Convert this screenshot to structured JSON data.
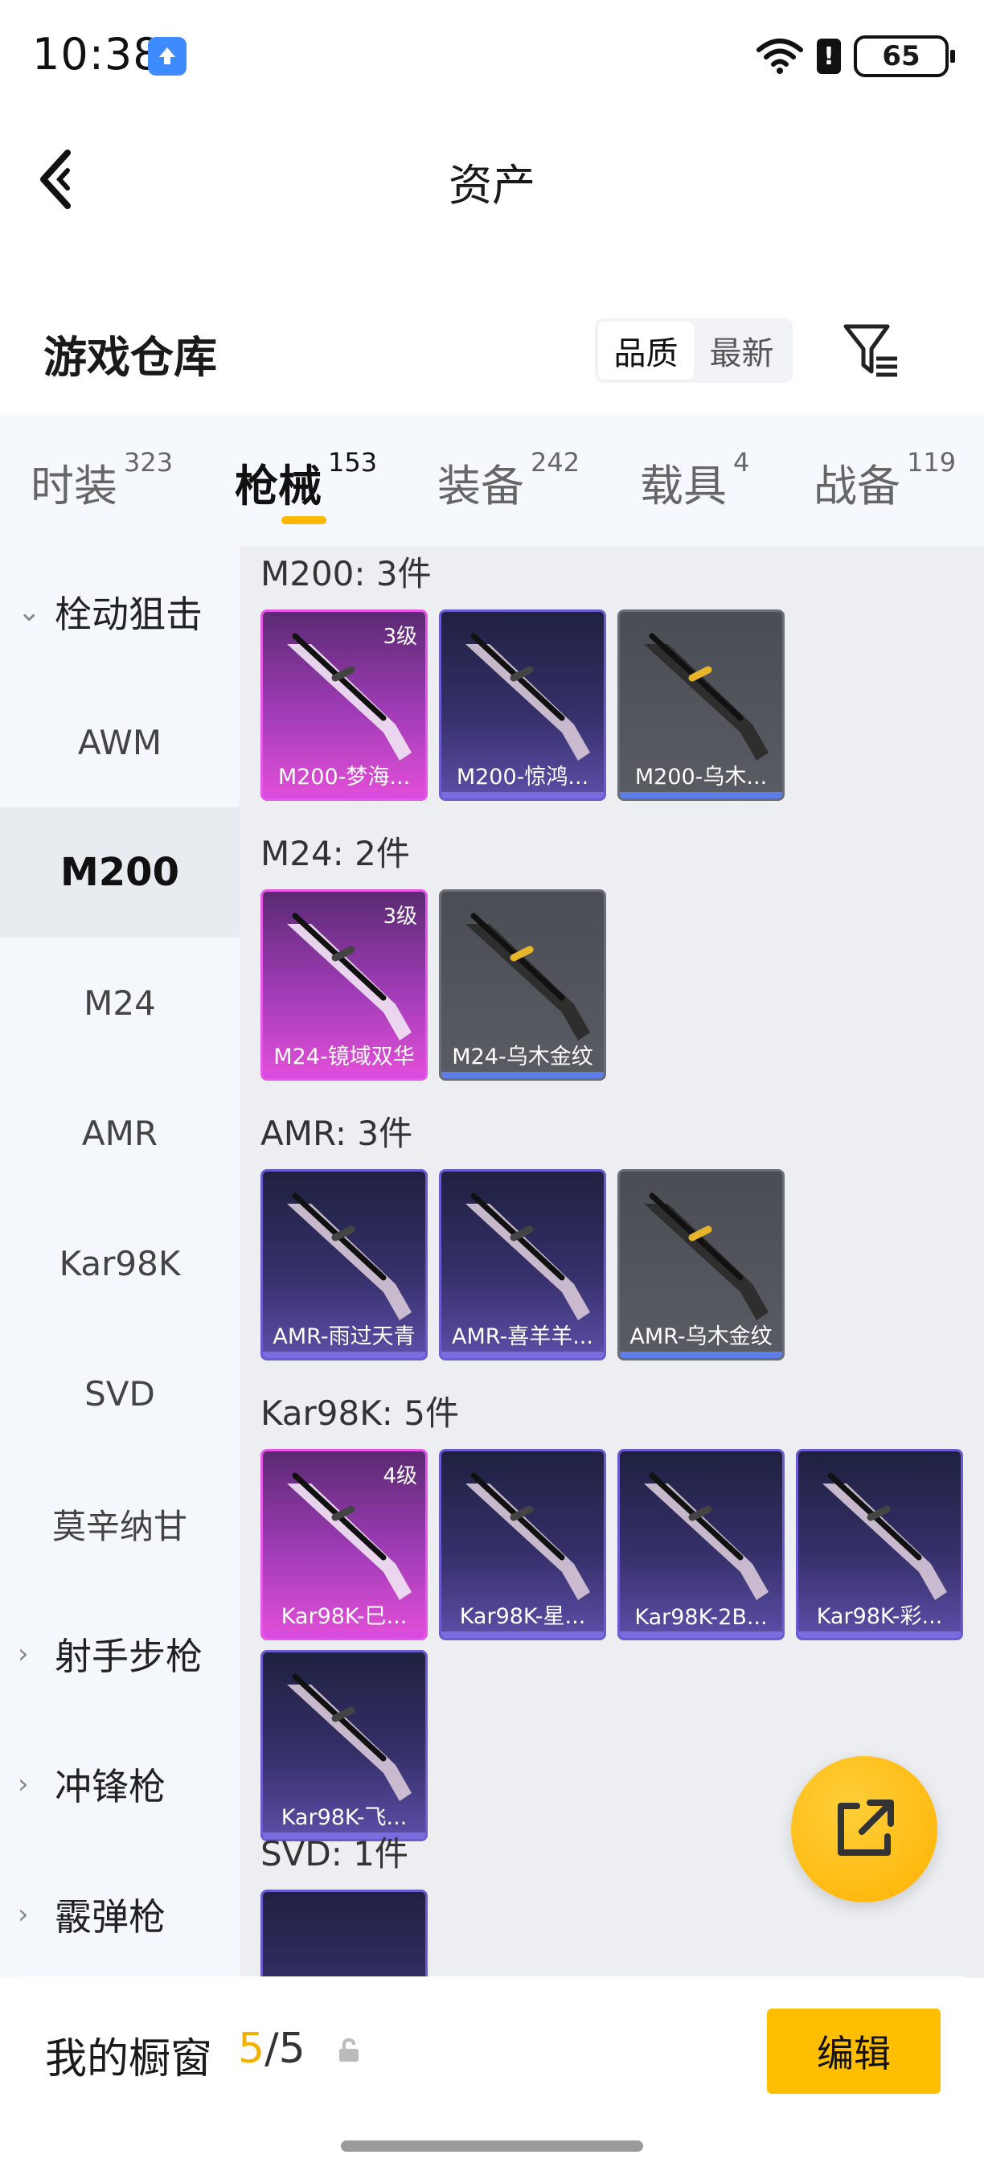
{
  "status": {
    "time": "10:38",
    "battery": "65",
    "alert": "!"
  },
  "nav": {
    "title": "资产"
  },
  "warehouse": {
    "title": "游戏仓库",
    "sort": [
      "品质",
      "最新"
    ]
  },
  "tabs": [
    {
      "label": "时装",
      "count": "323"
    },
    {
      "label": "枪械",
      "count": "153"
    },
    {
      "label": "装备",
      "count": "242"
    },
    {
      "label": "载具",
      "count": "4"
    },
    {
      "label": "战备",
      "count": "119"
    }
  ],
  "sidebar": {
    "group1": "栓动狙击",
    "items": [
      "AWM",
      "M200",
      "M24",
      "AMR",
      "Kar98K",
      "SVD",
      "莫辛纳甘"
    ],
    "groups": [
      "射手步枪",
      "冲锋枪",
      "霰弹枪"
    ]
  },
  "sections": [
    {
      "title": "M200: 3件",
      "cards": [
        {
          "name": "M200-梦海...",
          "level": "3级",
          "rarity": "pink"
        },
        {
          "name": "M200-惊鸿...",
          "level": "",
          "rarity": "purple"
        },
        {
          "name": "M200-乌木...",
          "level": "",
          "rarity": "gray"
        }
      ]
    },
    {
      "title": "M24: 2件",
      "cards": [
        {
          "name": "M24-镜域双华",
          "level": "3级",
          "rarity": "pink"
        },
        {
          "name": "M24-乌木金纹",
          "level": "",
          "rarity": "gray"
        }
      ]
    },
    {
      "title": "AMR: 3件",
      "cards": [
        {
          "name": "AMR-雨过天青",
          "level": "",
          "rarity": "purple"
        },
        {
          "name": "AMR-喜羊羊...",
          "level": "",
          "rarity": "purple"
        },
        {
          "name": "AMR-乌木金纹",
          "level": "",
          "rarity": "gray"
        }
      ]
    },
    {
      "title": "Kar98K: 5件",
      "cards": [
        {
          "name": "Kar98K-巳...",
          "level": "4级",
          "rarity": "pink"
        },
        {
          "name": "Kar98K-星...",
          "level": "",
          "rarity": "purple"
        },
        {
          "name": "Kar98K-2B...",
          "level": "",
          "rarity": "purple"
        },
        {
          "name": "Kar98K-彩...",
          "level": "",
          "rarity": "purple"
        },
        {
          "name": "Kar98K-飞...",
          "level": "",
          "rarity": "purple"
        }
      ]
    },
    {
      "title": "SVD: 1件",
      "cards": []
    }
  ],
  "showcase": {
    "label": "我的橱窗",
    "current": "5",
    "total": "5",
    "edit_label": "编辑"
  },
  "colors": {
    "accent": "#ffbe00",
    "pink": "#e657e8",
    "purple": "#6c5bd0"
  }
}
